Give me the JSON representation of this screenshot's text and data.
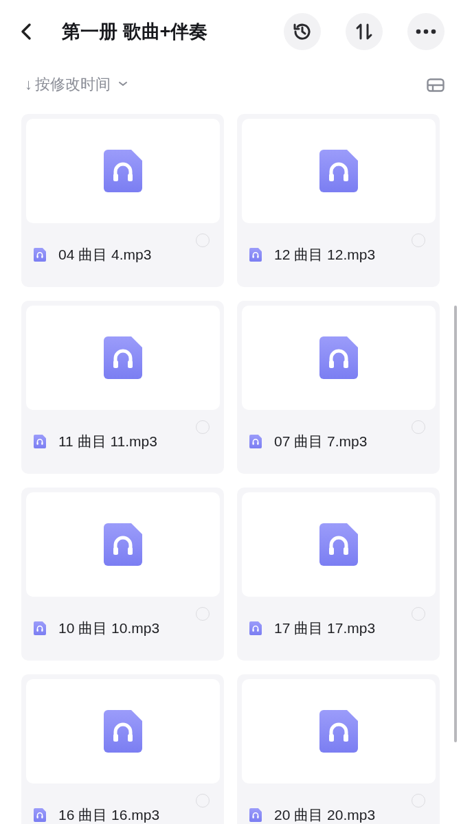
{
  "header": {
    "title": "第一册 歌曲+伴奏"
  },
  "sort_bar": {
    "arrow": "↓",
    "label": "按修改时间"
  },
  "files": [
    {
      "name": "04 曲目 4.mp3",
      "selected": false
    },
    {
      "name": "12 曲目 12.mp3",
      "selected": false
    },
    {
      "name": "11 曲目 11.mp3",
      "selected": false
    },
    {
      "name": "07 曲目 7.mp3",
      "selected": false
    },
    {
      "name": "10 曲目 10.mp3",
      "selected": false
    },
    {
      "name": "17 曲目 17.mp3",
      "selected": false
    },
    {
      "name": "16 曲目 16.mp3",
      "selected": false
    },
    {
      "name": "20 曲目 20.mp3",
      "selected": false
    }
  ]
}
